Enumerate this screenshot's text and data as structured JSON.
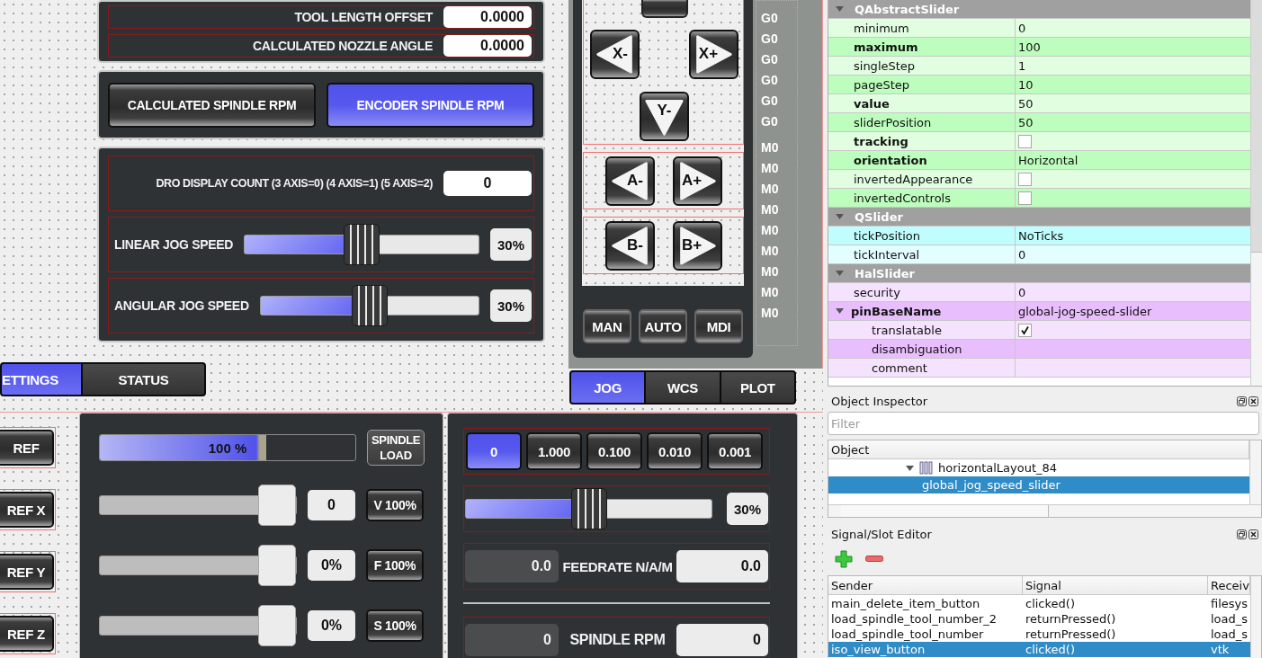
{
  "settings_panel": {
    "offset_rows": [
      {
        "label": "TOOL LENGTH OFFSET",
        "value": "0.0000"
      },
      {
        "label": "CALCULATED NOZZLE ANGLE",
        "value": "0.0000"
      }
    ],
    "rpm_buttons": [
      {
        "label": "CALCULATED SPINDLE RPM",
        "selected": false
      },
      {
        "label": "ENCODER SPINDLE RPM",
        "selected": true
      }
    ],
    "dro_count": {
      "label": "DRO DISPLAY COUNT (3 AXIS=0) (4 AXIS=1) (5 AXIS=2)",
      "value": "0"
    },
    "jog_speeds": [
      {
        "label": "LINEAR JOG SPEED",
        "level": 0.5,
        "reading": "30%"
      },
      {
        "label": "ANGULAR JOG SPEED",
        "level": 0.5,
        "reading": "30%"
      }
    ],
    "tabs": [
      {
        "label": "ETTINGS",
        "selected": true
      },
      {
        "label": "STATUS",
        "selected": false
      }
    ]
  },
  "jog_panel": {
    "xy_buttons": [
      {
        "label": "X-",
        "kind": "left"
      },
      {
        "label": "X+",
        "kind": "right"
      },
      {
        "label": "Y-",
        "kind": "down"
      }
    ],
    "rotary_rows": [
      [
        {
          "label": "A-",
          "kind": "left"
        },
        {
          "label": "A+",
          "kind": "right"
        }
      ],
      [
        {
          "label": "B-",
          "kind": "left"
        },
        {
          "label": "B+",
          "kind": "right"
        }
      ]
    ],
    "mode_buttons": [
      "MAN",
      "AUTO",
      "MDI"
    ],
    "g_codes": [
      "G0",
      "G0",
      "G0",
      "G0",
      "G0",
      "G0"
    ],
    "m_codes": [
      "M0",
      "M0",
      "M0",
      "M0",
      "M0",
      "M0",
      "M0",
      "M0",
      "M0"
    ],
    "tabs": [
      {
        "label": "JOG",
        "selected": true
      },
      {
        "label": "WCS",
        "selected": false
      },
      {
        "label": "PLOT",
        "selected": false
      }
    ]
  },
  "ref_buttons": [
    "REF",
    "REF X",
    "REF Y",
    "REF Z"
  ],
  "spindle_panel": {
    "load": {
      "reading": "100 %",
      "level": 0.65,
      "button": "SPINDLE LOAD"
    },
    "overrides": [
      {
        "level": 1,
        "value": "0",
        "button": "V 100%"
      },
      {
        "level": 1,
        "value": "0%",
        "button": "F 100%"
      },
      {
        "level": 1,
        "value": "0%",
        "button": "S 100%"
      }
    ]
  },
  "jog_rate_panel": {
    "increments": [
      {
        "label": "0",
        "selected": true
      },
      {
        "label": "1.000",
        "selected": false
      },
      {
        "label": "0.100",
        "selected": false
      },
      {
        "label": "0.010",
        "selected": false
      },
      {
        "label": "0.001",
        "selected": false
      }
    ],
    "rate": {
      "level": 0.5,
      "reading": "30%"
    },
    "feedrate": {
      "actual": "0.0",
      "label": "FEEDRATE N/A/M",
      "set": "0.0"
    },
    "spindle_rpm": {
      "actual": "0",
      "label": "SPINDLE RPM",
      "set": "0"
    }
  },
  "property_editor": {
    "sections": [
      {
        "title": "QAbstractSlider",
        "expanded": true,
        "color": "#bdfdbd",
        "rows": [
          {
            "name": "minimum",
            "kind": "text",
            "value": "0",
            "bold": false,
            "dark": false
          },
          {
            "name": "maximum",
            "kind": "text",
            "value": "100",
            "bold": true,
            "dark": true
          },
          {
            "name": "singleStep",
            "kind": "text",
            "value": "1",
            "bold": false,
            "dark": false
          },
          {
            "name": "pageStep",
            "kind": "text",
            "value": "10",
            "bold": false,
            "dark": true
          },
          {
            "name": "value",
            "kind": "text",
            "value": "50",
            "bold": true,
            "dark": false
          },
          {
            "name": "sliderPosition",
            "kind": "text",
            "value": "50",
            "bold": false,
            "dark": true
          },
          {
            "name": "tracking",
            "kind": "checkbox",
            "checked": false,
            "bold": true,
            "dark": false
          },
          {
            "name": "orientation",
            "kind": "text",
            "value": "Horizontal",
            "bold": true,
            "dark": true
          },
          {
            "name": "invertedAppearance",
            "kind": "checkbox",
            "checked": false,
            "bold": false,
            "dark": false
          },
          {
            "name": "invertedControls",
            "kind": "checkbox",
            "checked": false,
            "bold": false,
            "dark": true
          }
        ]
      },
      {
        "title": "QSlider",
        "expanded": true,
        "color": "#c0fdfd",
        "rows": [
          {
            "name": "tickPosition",
            "kind": "text",
            "value": "NoTicks",
            "bold": false,
            "dark": true
          },
          {
            "name": "tickInterval",
            "kind": "text",
            "value": "0",
            "bold": false,
            "dark": false
          }
        ]
      },
      {
        "title": "HalSlider",
        "expanded": true,
        "color": "#e8befd",
        "rows": [
          {
            "name": "security",
            "kind": "text",
            "value": "0",
            "bold": false,
            "dark": false
          },
          {
            "name": "pinBaseName",
            "kind": "text",
            "value": "global-jog-speed-slider",
            "bold": true,
            "dark": true,
            "expanded": true,
            "children": [
              {
                "name": "translatable",
                "kind": "checkbox",
                "checked": true,
                "bold": false,
                "dark": false
              },
              {
                "name": "disambiguation",
                "kind": "text",
                "bold": false,
                "dark": true
              },
              {
                "name": "comment",
                "kind": "text",
                "bold": false,
                "dark": false
              }
            ]
          }
        ]
      }
    ]
  },
  "object_inspector": {
    "title": "Object Inspector",
    "filter": {
      "placeholder": "Filter"
    },
    "column": "Object",
    "items": [
      {
        "label": "horizontalLayout_84",
        "expanded": true,
        "selected": false,
        "children": [
          {
            "label": "global_jog_speed_slider",
            "selected": true
          }
        ]
      }
    ]
  },
  "signal_slot_editor": {
    "title": "Signal/Slot Editor",
    "columns": [
      "Sender",
      "Signal",
      "Receiv"
    ],
    "rows": [
      {
        "cells": [
          "main_delete_item_button",
          "clicked()",
          "filesys"
        ],
        "selected": false
      },
      {
        "cells": [
          "load_spindle_tool_number_2",
          "returnPressed()",
          "load_s"
        ],
        "selected": false
      },
      {
        "cells": [
          "load_spindle_tool_number",
          "returnPressed()",
          "load_s"
        ],
        "selected": false
      },
      {
        "cells": [
          "iso_view_button",
          "clicked()",
          "vtk"
        ],
        "selected": true
      }
    ]
  }
}
